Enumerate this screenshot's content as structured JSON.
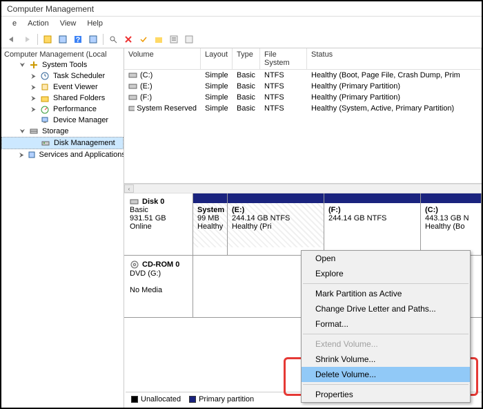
{
  "window": {
    "title": "Computer Management"
  },
  "menubar": [
    "e",
    "Action",
    "View",
    "Help"
  ],
  "tree": {
    "root": "Computer Management (Local",
    "system_tools": "System Tools",
    "task_scheduler": "Task Scheduler",
    "event_viewer": "Event Viewer",
    "shared_folders": "Shared Folders",
    "performance": "Performance",
    "device_manager": "Device Manager",
    "storage": "Storage",
    "disk_management": "Disk Management",
    "services": "Services and Applications"
  },
  "volumes": {
    "headers": {
      "volume": "Volume",
      "layout": "Layout",
      "type": "Type",
      "fs": "File System",
      "status": "Status"
    },
    "rows": [
      {
        "vol": "(C:)",
        "lay": "Simple",
        "type": "Basic",
        "fs": "NTFS",
        "st": "Healthy (Boot, Page File, Crash Dump, Prim"
      },
      {
        "vol": "(E:)",
        "lay": "Simple",
        "type": "Basic",
        "fs": "NTFS",
        "st": "Healthy (Primary Partition)"
      },
      {
        "vol": "(F:)",
        "lay": "Simple",
        "type": "Basic",
        "fs": "NTFS",
        "st": "Healthy (Primary Partition)"
      },
      {
        "vol": "System Reserved",
        "lay": "Simple",
        "type": "Basic",
        "fs": "NTFS",
        "st": "Healthy (System, Active, Primary Partition)"
      }
    ]
  },
  "disk0": {
    "name": "Disk 0",
    "type": "Basic",
    "size": "931.51 GB",
    "status": "Online",
    "parts": {
      "p0": {
        "label": "System",
        "size": "99 MB",
        "status": "Healthy"
      },
      "p1": {
        "label": "(E:)",
        "size": "244.14 GB NTFS",
        "status": "Healthy (Pri"
      },
      "p2": {
        "label": "(F:)",
        "size": "244.14 GB NTFS",
        "status": ""
      },
      "p3": {
        "label": "(C:)",
        "size": "443.13 GB N",
        "status": "Healthy (Bo"
      }
    }
  },
  "cdrom": {
    "name": "CD-ROM 0",
    "type": "DVD (G:)",
    "status": "No Media"
  },
  "legend": {
    "unalloc": "Unallocated",
    "primary": "Primary partition"
  },
  "context": {
    "open": "Open",
    "explore": "Explore",
    "mark": "Mark Partition as Active",
    "change": "Change Drive Letter and Paths...",
    "format": "Format...",
    "extend": "Extend Volume...",
    "shrink": "Shrink Volume...",
    "delete": "Delete Volume...",
    "properties": "Properties"
  }
}
